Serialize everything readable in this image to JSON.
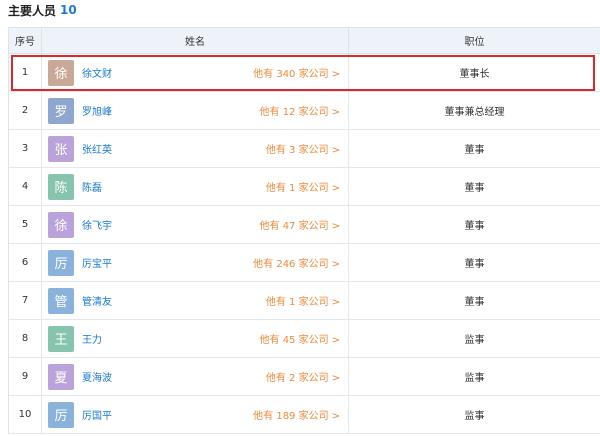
{
  "header": {
    "title": "主要人员",
    "count": "10"
  },
  "columns": {
    "index": "序号",
    "name": "姓名",
    "position": "职位"
  },
  "chevron": ">",
  "rows": [
    {
      "index": "1",
      "avatar": "徐",
      "avatar_color": "#c9a897",
      "name": "徐文财",
      "companies": "他有 340 家公司",
      "position": "董事长"
    },
    {
      "index": "2",
      "avatar": "罗",
      "avatar_color": "#8fa6cf",
      "name": "罗旭峰",
      "companies": "他有 12 家公司",
      "position": "董事兼总经理"
    },
    {
      "index": "3",
      "avatar": "张",
      "avatar_color": "#b9a3da",
      "name": "张红英",
      "companies": "他有 3 家公司",
      "position": "董事"
    },
    {
      "index": "4",
      "avatar": "陈",
      "avatar_color": "#86c4ae",
      "name": "陈磊",
      "companies": "他有 1 家公司",
      "position": "董事"
    },
    {
      "index": "5",
      "avatar": "徐",
      "avatar_color": "#b9a3da",
      "name": "徐飞宇",
      "companies": "他有 47 家公司",
      "position": "董事"
    },
    {
      "index": "6",
      "avatar": "厉",
      "avatar_color": "#8ab3dc",
      "name": "厉宝平",
      "companies": "他有 246 家公司",
      "position": "董事"
    },
    {
      "index": "7",
      "avatar": "管",
      "avatar_color": "#8ab3dc",
      "name": "管清友",
      "companies": "他有 1 家公司",
      "position": "董事"
    },
    {
      "index": "8",
      "avatar": "王",
      "avatar_color": "#86c4ae",
      "name": "王力",
      "companies": "他有 45 家公司",
      "position": "监事"
    },
    {
      "index": "9",
      "avatar": "夏",
      "avatar_color": "#b9a3da",
      "name": "夏海波",
      "companies": "他有 2 家公司",
      "position": "监事"
    },
    {
      "index": "10",
      "avatar": "厉",
      "avatar_color": "#8ab3dc",
      "name": "厉国平",
      "companies": "他有 189 家公司",
      "position": "监事"
    }
  ],
  "highlight_color": "#e0262b"
}
